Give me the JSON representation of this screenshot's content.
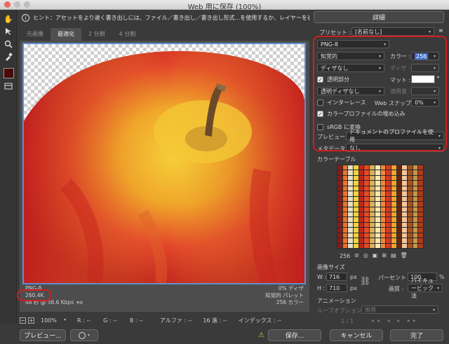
{
  "window": {
    "title": "Web 用に保存 (100%)"
  },
  "hint": {
    "text": "ヒント：アセットをより速く書き出しには、ファイル／書き出し／書き出し形式...を使用するか、レイヤーを右クリックして使用。"
  },
  "tabs": [
    "元画像",
    "最適化",
    "2 分割",
    "4 分割"
  ],
  "preview": {
    "format": "PNG-8",
    "file_size": "260.4K",
    "load_time": "48 秒 @ 56.6 Kbps",
    "dither": "0% ディザ",
    "palette_type": "知覚的 パレット",
    "colors_count": "256 カラー"
  },
  "status": {
    "zoom": "100%",
    "r": "R : --",
    "g": "G : --",
    "b": "B : --",
    "alpha": "アルファ : --",
    "hex": "16 進 : --",
    "index": "インデックス : --"
  },
  "buttons": {
    "preview": "プレビュー...",
    "save": "保存...",
    "cancel": "キャンセル",
    "done": "完了"
  },
  "right": {
    "details": "詳細",
    "preset_label": "プリセット :",
    "preset_value": "[名前なし]",
    "format": "PNG-8",
    "reduction": "知覚的",
    "colors_label": "カラー :",
    "colors_value": "256",
    "dither_method": "ディザなし",
    "dither_label": "ディザ :",
    "transparency": "透明部分",
    "matte_label": "マット :",
    "transparency_dither": "透明ディザなし",
    "amount_label": "適用量 :",
    "interlace": "インターレース",
    "web_snap_label": "Web スナップ :",
    "web_snap_value": "0%",
    "embed_profile": "カラープロファイルの埋め込み",
    "srgb": "sRGB に変換",
    "preview_label": "プレビュー :",
    "preview_value": "ドキュメントのプロファイルを使用",
    "metadata_label": "メタデータ :",
    "metadata_value": "なし",
    "color_table_label": "カラーテーブル",
    "color_table_count": "256",
    "image_size_label": "画像サイズ",
    "w_label": "W :",
    "w_value": "716",
    "h_label": "H :",
    "h_value": "710",
    "px": "px",
    "percent_label": "パーセント :",
    "percent_value": "100",
    "percent_unit": "%",
    "quality_label": "画質 :",
    "quality_value": "バイキュービック法",
    "animation_label": "アニメーション",
    "loop_label": "ループオプション :",
    "loop_value": "無限",
    "frame": "1 / 1"
  }
}
